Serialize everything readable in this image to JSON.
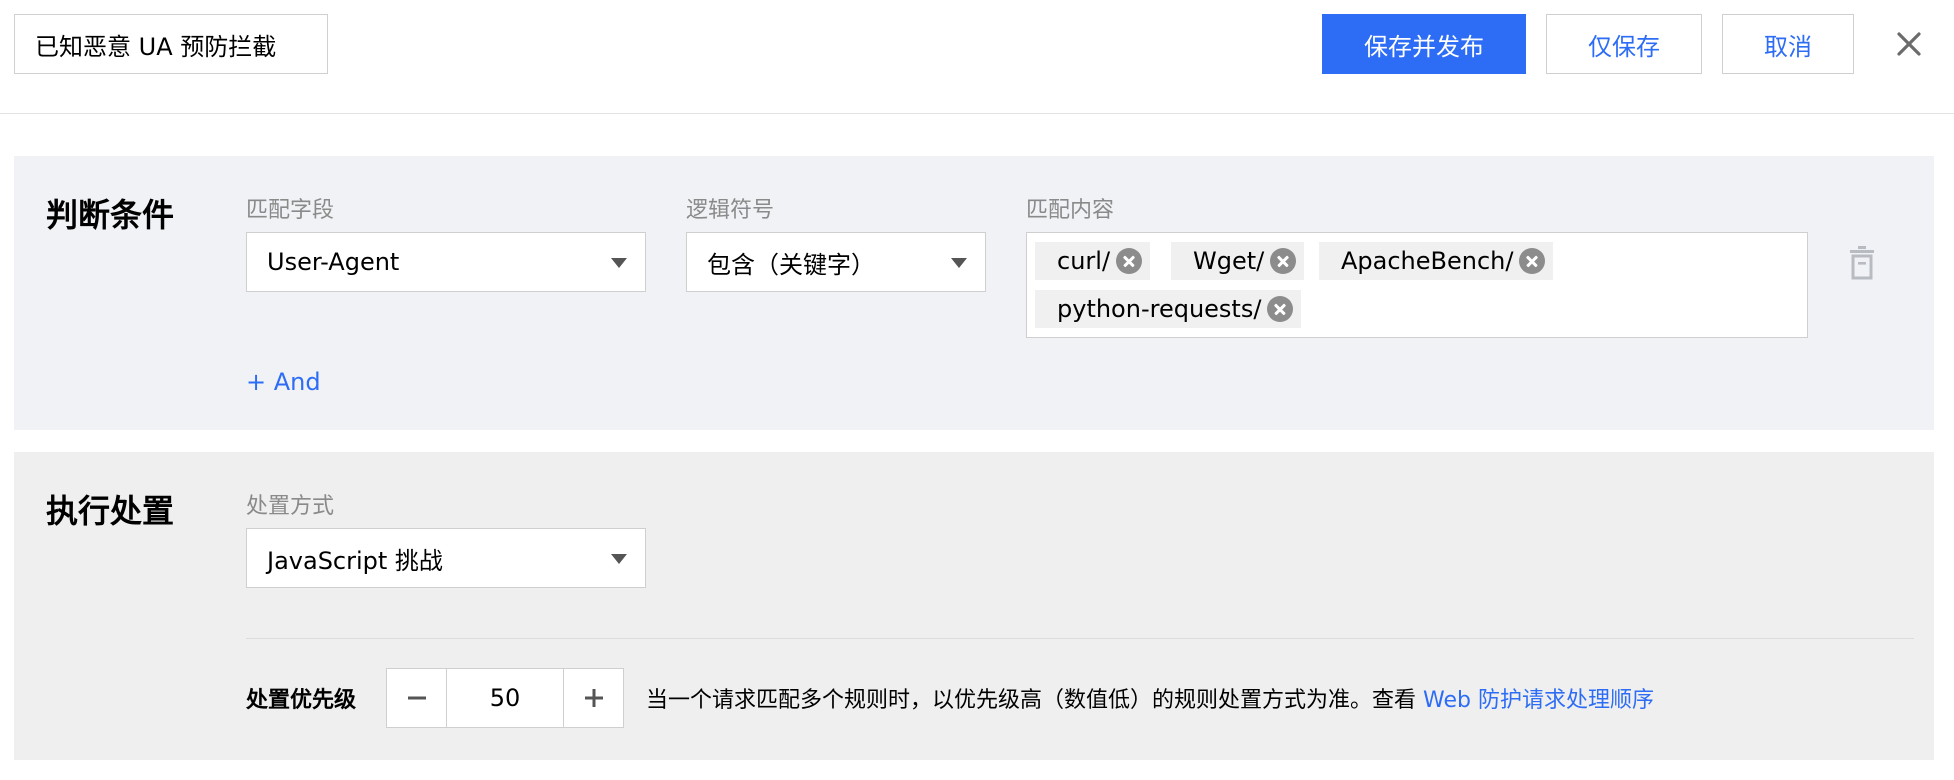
{
  "header": {
    "rule_name": "已知恶意 UA 预防拦截",
    "save_publish_label": "保存并发布",
    "save_only_label": "仅保存",
    "cancel_label": "取消"
  },
  "condition": {
    "section_title": "判断条件",
    "match_field_label": "匹配字段",
    "match_field_value": "User-Agent",
    "logic_label": "逻辑符号",
    "logic_value": "包含（关键字）",
    "content_label": "匹配内容",
    "tags": [
      "curl/",
      "Wget/",
      "ApacheBench/",
      "python-requests/"
    ],
    "add_and_label": "+ And"
  },
  "action": {
    "section_title": "执行处置",
    "method_label": "处置方式",
    "method_value": "JavaScript 挑战",
    "priority_label": "处置优先级",
    "priority_value": "50",
    "priority_desc": "当一个请求匹配多个规则时，以优先级高（数值低）的规则处置方式为准。查看 ",
    "priority_link": "Web 防护请求处理顺序"
  },
  "colors": {
    "primary": "#2d6df6",
    "condition_bg": "#f0f2f5",
    "action_bg": "#efefef"
  }
}
